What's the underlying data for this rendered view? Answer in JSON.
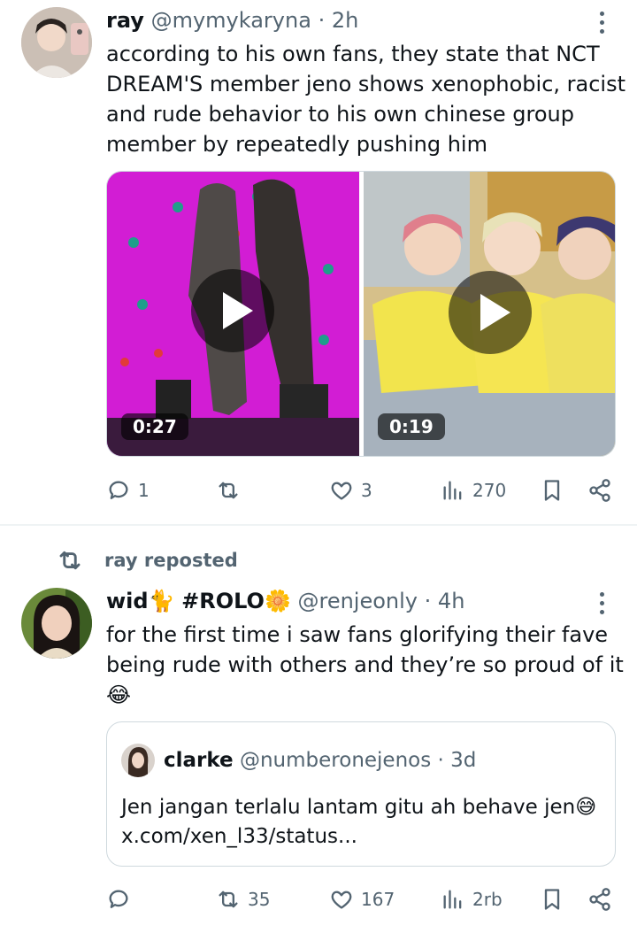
{
  "tweet1": {
    "name": "ray",
    "handle": "@mymykaryna",
    "time": "2h",
    "text_lines": [
      "according to his own fans, they state that NCT",
      "DREAM'S member jeno shows xenophobic, racist",
      "and rude behavior to his own chinese group",
      "member by repeatedly pushing him"
    ],
    "videos": [
      {
        "duration": "0:27"
      },
      {
        "duration": "0:19"
      }
    ],
    "actions": {
      "replies": "1",
      "reposts": "",
      "likes": "3",
      "views": "270"
    }
  },
  "repost_label": "ray reposted",
  "tweet2": {
    "name": "wid",
    "name_emoji_1": "🐈",
    "name_tag": "#ROLO",
    "name_emoji_2": "🌼",
    "handle": "@renjeonly",
    "time": "4h",
    "text_lines": [
      "for the first time i saw fans glorifying their fave",
      "being rude with others and they’re so proud of it",
      "😂"
    ],
    "quote": {
      "name": "clarke",
      "handle": "@numberonejenos",
      "time": "3d",
      "text_line1": "Jen jangan terlalu lantam gitu ah behave jen😅",
      "text_line2": "x.com/xen_l33/status..."
    },
    "actions": {
      "replies": "",
      "reposts": "35",
      "likes": "167",
      "views": "2rb"
    }
  },
  "icons": [
    "reply-icon",
    "repost-icon",
    "like-icon",
    "views-icon",
    "bookmark-icon",
    "share-icon",
    "more-icon",
    "play-icon"
  ],
  "colors": {
    "text": "#0f1419",
    "secondary": "#536471",
    "border": "#cfd9de",
    "divider": "#eff3f4"
  }
}
